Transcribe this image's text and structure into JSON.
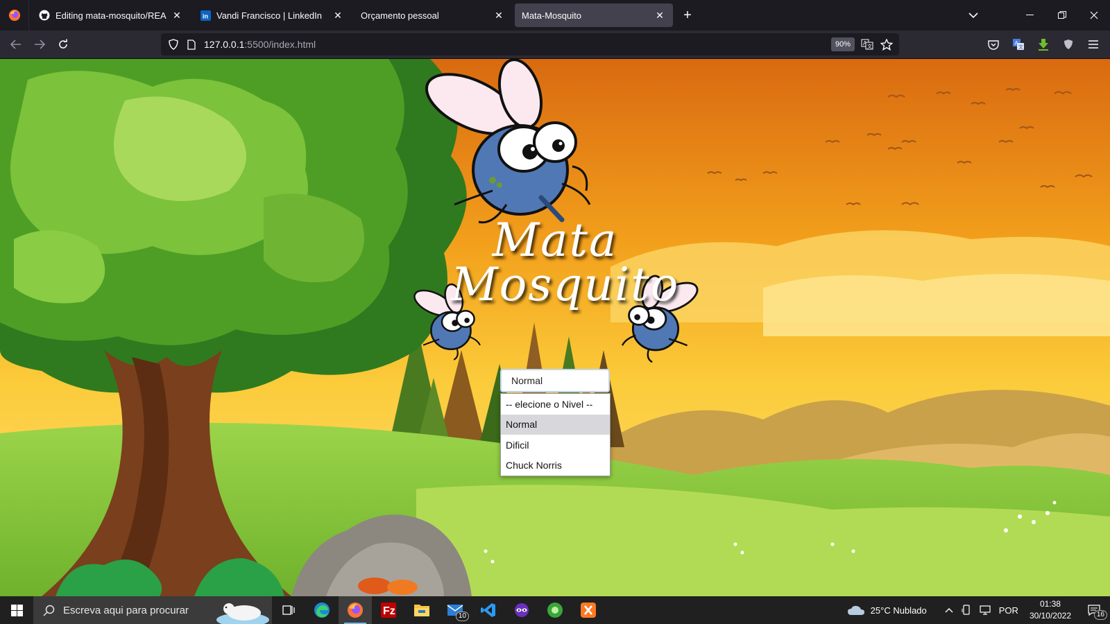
{
  "browser": {
    "tabs": [
      {
        "title": "Editing mata-mosquito/README.md",
        "icon": "github-icon",
        "active": false
      },
      {
        "title": "Vandi Francisco | LinkedIn",
        "icon": "linkedin-icon",
        "active": false
      },
      {
        "title": "Orçamento pessoal",
        "icon": "",
        "active": false
      },
      {
        "title": "Mata-Mosquito",
        "icon": "",
        "active": true
      }
    ],
    "url_host": "127.0.0.1",
    "url_path": ":5500/index.html",
    "zoom": "90%"
  },
  "page": {
    "title_line1": "Mata",
    "title_line2": "Mosquito",
    "level_select": {
      "selected": "Normal",
      "options": [
        "-- elecione o Nivel --",
        "Normal",
        "Dificil",
        "Chuck Norris"
      ],
      "highlighted_index": 1
    }
  },
  "taskbar": {
    "search_placeholder": "Escreva aqui para procurar",
    "apps": [
      "task-view-icon",
      "edge-icon",
      "firefox-icon",
      "filezilla-icon",
      "file-explorer-icon",
      "mail-icon",
      "vscode-icon",
      "mask-app-icon",
      "green-app-icon",
      "xampp-icon"
    ],
    "mail_badge": "10",
    "weather": "25°C  Nublado",
    "language": "POR",
    "time": "01:38",
    "date": "30/10/2022",
    "notifications": "16"
  },
  "colors": {
    "sky_top": "#e07b12",
    "sky_mid": "#f7b21c",
    "grass": "#8dc63f",
    "accent": "#76b9ed"
  }
}
